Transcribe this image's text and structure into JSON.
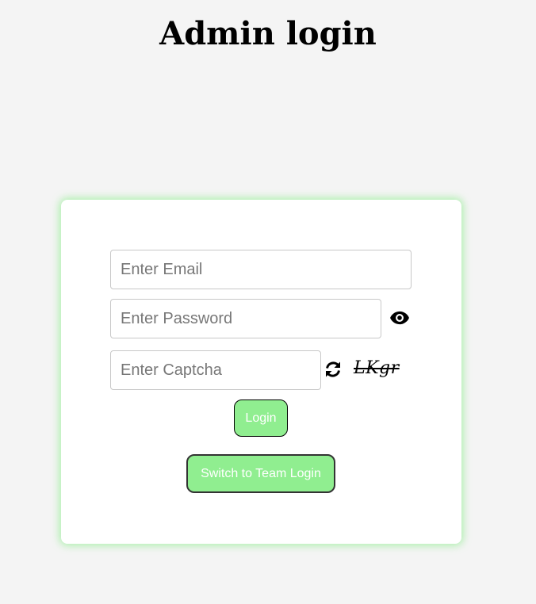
{
  "header": {
    "title": "Admin login"
  },
  "form": {
    "email_placeholder": "Enter Email",
    "password_placeholder": "Enter Password",
    "captcha_placeholder": "Enter Captcha",
    "captcha_code": "LKgr",
    "login_label": "Login",
    "switch_label": "Switch to Team Login"
  },
  "icons": {
    "password_toggle": "eye-icon",
    "captcha_refresh": "refresh-icon"
  },
  "colors": {
    "background": "#f4f4f4",
    "card": "#ffffff",
    "accent": "#90ee90",
    "card_glow": "#90ee90"
  }
}
